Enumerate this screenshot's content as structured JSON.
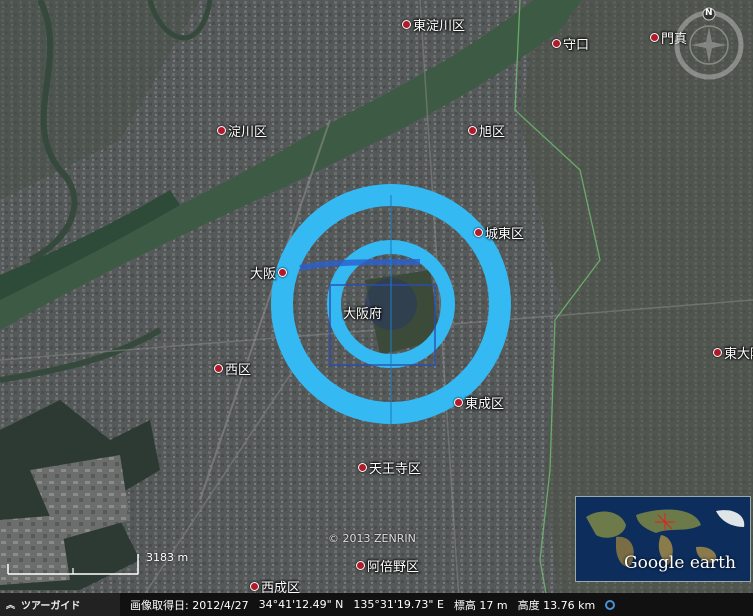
{
  "places": [
    {
      "name": "淀川区"
    },
    {
      "name": "東淀川区"
    },
    {
      "name": "守口"
    },
    {
      "name": "門真"
    },
    {
      "name": "旭区"
    },
    {
      "name": "城東区"
    },
    {
      "name": "大阪"
    },
    {
      "name": "大阪府"
    },
    {
      "name": "西区"
    },
    {
      "name": "東成区"
    },
    {
      "name": "東大阪"
    },
    {
      "name": "天王寺区"
    },
    {
      "name": "阿倍野区"
    },
    {
      "name": "西成区"
    }
  ],
  "compass": {
    "north_label": "N"
  },
  "copyright": "© 2013 ZENRIN",
  "scale": {
    "label": "3183 m"
  },
  "overview": {
    "brand": "Google earth"
  },
  "statusbar": {
    "tour_label": "ツアーガイド",
    "imagery_date": "画像取得日: 2012/4/27",
    "lat": "34°41'12.49\" N",
    "lon": "135°31'19.73\" E",
    "elevation": "標高   17 m",
    "eye_alt": "高度  13.76 km"
  },
  "colors": {
    "ring": "#34b9f2",
    "ring_dark": "#2a8fd0",
    "pin": "#b01a2a",
    "river": "#3d5a44"
  }
}
